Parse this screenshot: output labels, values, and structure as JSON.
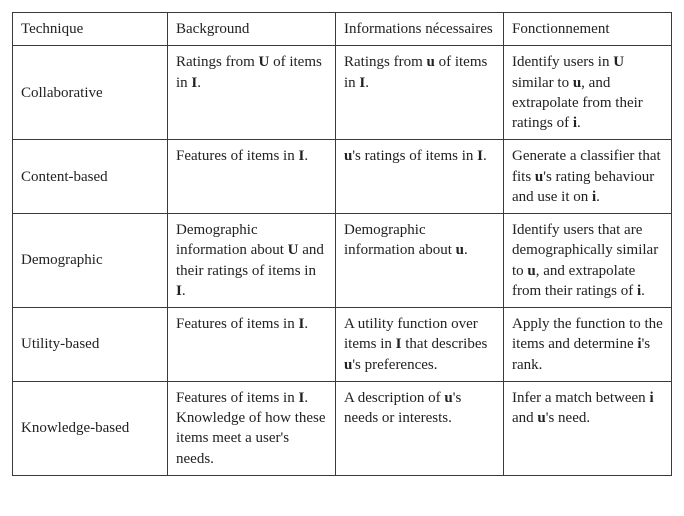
{
  "headers": {
    "technique": "Technique",
    "background": "Background",
    "informations": "Informations nécessaires",
    "fonctionnement": "Fonctionnement"
  },
  "rows": [
    {
      "technique": "Collaborative",
      "background": [
        {
          "t": "Ratings from "
        },
        {
          "t": "U",
          "b": true
        },
        {
          "t": " of items in "
        },
        {
          "t": "I",
          "b": true
        },
        {
          "t": "."
        }
      ],
      "informations": [
        {
          "t": "Ratings from "
        },
        {
          "t": "u",
          "b": true
        },
        {
          "t": " of items in "
        },
        {
          "t": "I",
          "b": true
        },
        {
          "t": "."
        }
      ],
      "fonctionnement": [
        {
          "t": "Identify users in "
        },
        {
          "t": "U",
          "b": true
        },
        {
          "t": " similar to "
        },
        {
          "t": "u",
          "b": true
        },
        {
          "t": ", and extrapolate from their ratings of "
        },
        {
          "t": "i",
          "b": true
        },
        {
          "t": "."
        }
      ]
    },
    {
      "technique": "Content-based",
      "background": [
        {
          "t": "Features of items in "
        },
        {
          "t": "I",
          "b": true
        },
        {
          "t": "."
        }
      ],
      "informations": [
        {
          "t": "u",
          "b": true
        },
        {
          "t": "'s ratings of items in "
        },
        {
          "t": "I",
          "b": true
        },
        {
          "t": "."
        }
      ],
      "fonctionnement": [
        {
          "t": "Generate a classifier that fits "
        },
        {
          "t": "u",
          "b": true
        },
        {
          "t": "'s rating behaviour and use it on "
        },
        {
          "t": "i",
          "b": true
        },
        {
          "t": "."
        }
      ]
    },
    {
      "technique": "Demographic",
      "background": [
        {
          "t": "Demographic information about "
        },
        {
          "t": "U",
          "b": true
        },
        {
          "t": " and their ratings of items in "
        },
        {
          "t": "I",
          "b": true
        },
        {
          "t": "."
        }
      ],
      "informations": [
        {
          "t": "Demographic information about "
        },
        {
          "t": "u",
          "b": true
        },
        {
          "t": "."
        }
      ],
      "fonctionnement": [
        {
          "t": "Identify users that are demographically similar to "
        },
        {
          "t": "u",
          "b": true
        },
        {
          "t": ", and extrapolate from their ratings of "
        },
        {
          "t": "i",
          "b": true
        },
        {
          "t": "."
        }
      ]
    },
    {
      "technique": "Utility-based",
      "background": [
        {
          "t": "Features of items in "
        },
        {
          "t": "I",
          "b": true
        },
        {
          "t": "."
        }
      ],
      "informations": [
        {
          "t": "A utility function over items in "
        },
        {
          "t": "I",
          "b": true
        },
        {
          "t": " that describes "
        },
        {
          "t": "u",
          "b": true
        },
        {
          "t": "'s preferences."
        }
      ],
      "fonctionnement": [
        {
          "t": "Apply the function to the items and determine "
        },
        {
          "t": "i",
          "b": true
        },
        {
          "t": "'s rank."
        }
      ]
    },
    {
      "technique": "Knowledge-based",
      "background": [
        {
          "t": "Features of items in "
        },
        {
          "t": "I",
          "b": true
        },
        {
          "t": ". Knowledge of how these items meet a user's needs."
        }
      ],
      "informations": [
        {
          "t": "A description of "
        },
        {
          "t": "u",
          "b": true
        },
        {
          "t": "'s needs or interests."
        }
      ],
      "fonctionnement": [
        {
          "t": "Infer a match between "
        },
        {
          "t": "i",
          "b": true
        },
        {
          "t": " and "
        },
        {
          "t": "u",
          "b": true
        },
        {
          "t": "'s need."
        }
      ]
    }
  ]
}
